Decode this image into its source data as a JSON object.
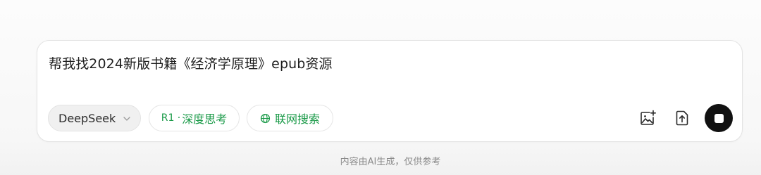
{
  "composer": {
    "prompt_text": "帮我找2024新版书籍《经济学原理》epub资源"
  },
  "toolbar": {
    "model_label": "DeepSeek",
    "model_dropdown_icon": "chevron-down-icon",
    "think_prefix": "R1 ·",
    "think_label": "深度思考",
    "search_icon": "globe-icon",
    "search_label": "联网搜索",
    "image_icon": "image-add-icon",
    "upload_icon": "upload-file-icon",
    "stop_icon": "stop-icon"
  },
  "footer": {
    "disclaimer": "内容由AI生成，仅供参考"
  },
  "colors": {
    "accent_green": "#1a9a48",
    "stop_button": "#111111"
  }
}
